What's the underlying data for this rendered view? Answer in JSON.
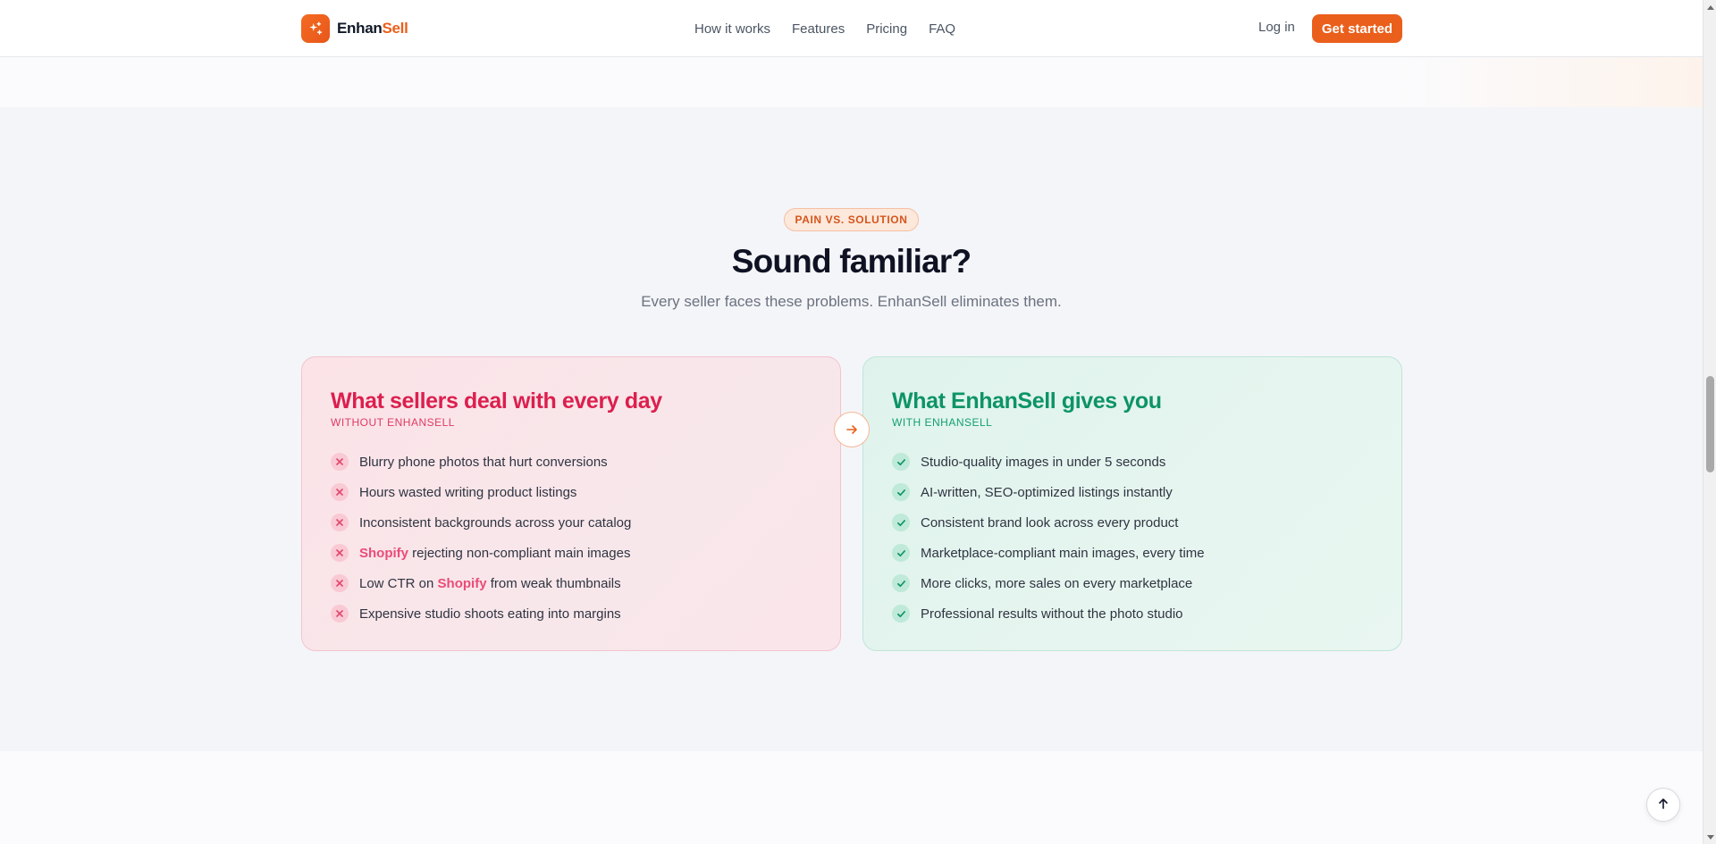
{
  "brand": {
    "name_a": "Enhan",
    "name_b": "Sell",
    "accent": "#ea5f1c"
  },
  "nav": {
    "links": [
      "How it works",
      "Features",
      "Pricing",
      "FAQ"
    ],
    "login": "Log in",
    "cta": "Get started"
  },
  "section": {
    "eyebrow": "PAIN VS. SOLUTION",
    "title": "Sound familiar?",
    "subtitle": "Every seller faces these problems. EnhanSell eliminates them."
  },
  "pain": {
    "title": "What sellers deal with every day",
    "tag": "WITHOUT ENHANSELL",
    "color": "#dc1f4e",
    "items": [
      {
        "before": "Blurry phone photos that hurt conversions"
      },
      {
        "before": "Hours wasted writing product listings"
      },
      {
        "before": "Inconsistent backgrounds across your catalog"
      },
      {
        "hl": "Shopify",
        "after": " rejecting non-compliant main images"
      },
      {
        "before": "Low CTR on ",
        "hl": "Shopify",
        "after": " from weak thumbnails"
      },
      {
        "before": "Expensive studio shoots eating into margins"
      }
    ]
  },
  "gain": {
    "title": "What EnhanSell gives you",
    "tag": "WITH ENHANSELL",
    "color": "#0d9466",
    "items": [
      "Studio-quality images in under 5 seconds",
      "AI-written, SEO-optimized listings instantly",
      "Consistent brand look across every product",
      "Marketplace-compliant main images, every time",
      "More clicks, more sales on every marketplace",
      "Professional results without the photo studio"
    ]
  },
  "icons": {
    "logo": "sparkle-icon",
    "pain_item": "x-icon",
    "gain_item": "check-icon",
    "middle": "arrow-right-icon",
    "back_to_top": "arrow-up-icon"
  }
}
